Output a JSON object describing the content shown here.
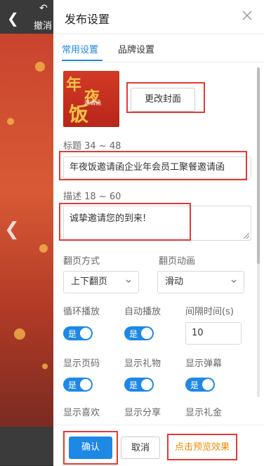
{
  "background": {
    "undo_label": "撤消"
  },
  "dialog": {
    "title": "发布设置"
  },
  "tabs": [
    {
      "label": "常用设置"
    },
    {
      "label": "品牌设置"
    }
  ],
  "cover": {
    "change_label": "更改封面",
    "art_chars": [
      "年",
      "夜",
      "饭"
    ],
    "art_sub": "邀请函"
  },
  "title_field": {
    "label": "标题 34 ~ 48",
    "value": "年夜饭邀请函企业年会员工聚餐邀请函"
  },
  "desc_field": {
    "label": "描述 18 ~ 60",
    "value": "诚挚邀请您的到来!"
  },
  "page_turn": {
    "mode_label": "翻页方式",
    "mode_value": "上下翻页",
    "anim_label": "翻页动画",
    "anim_value": "滑动"
  },
  "toggles": {
    "on_label": "是",
    "loop_label": "循环播放",
    "autoplay_label": "自动播放",
    "interval_label": "间隔时间(s)",
    "interval_value": "10",
    "show_pagenum_label": "显示页码",
    "show_gift_label": "显示礼物",
    "show_danmaku_label": "显示弹幕",
    "show_like_label": "显示喜欢",
    "show_share_label": "显示分享",
    "show_giftmoney_label": "显示礼金"
  },
  "footer": {
    "confirm_label": "确认",
    "cancel_label": "取消",
    "preview_label": "点击预览效果"
  },
  "colors": {
    "accent": "#1e88e5",
    "highlight": "#e53935",
    "preview": "#f08a00"
  }
}
